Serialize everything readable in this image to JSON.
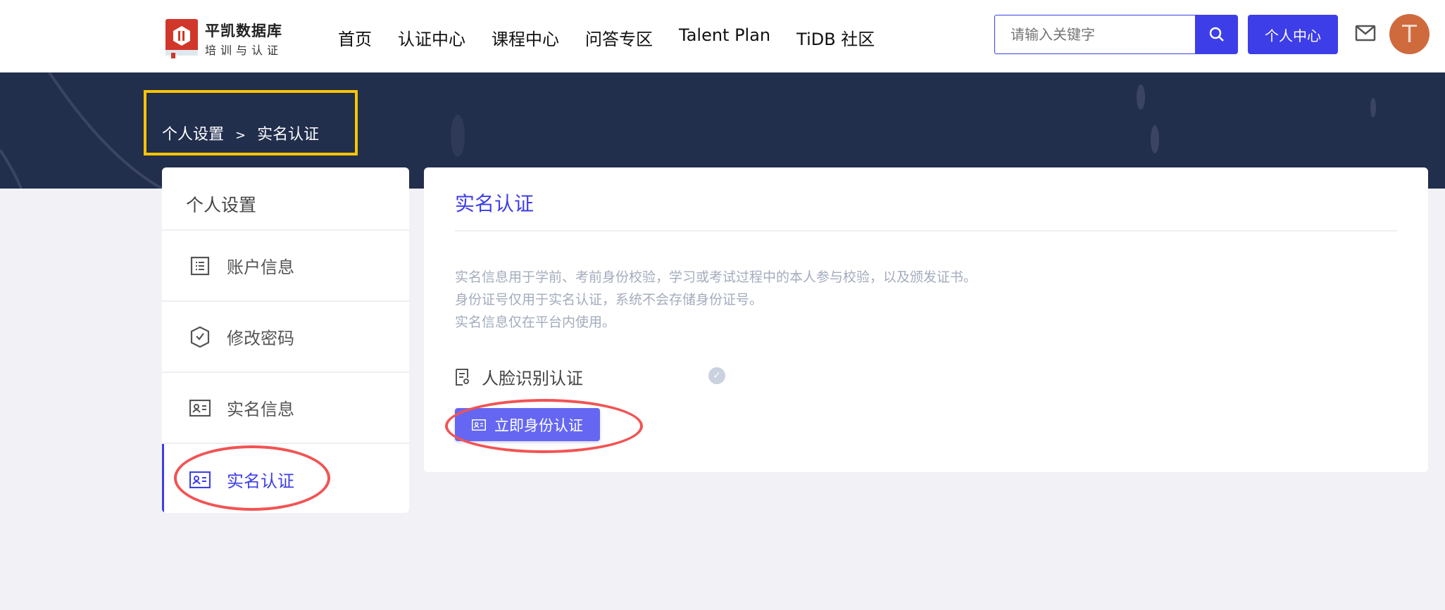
{
  "header": {
    "logo_title": "平凯数据库",
    "logo_subtitle": "培训与认证",
    "nav": [
      "首页",
      "认证中心",
      "课程中心",
      "问答专区",
      "Talent Plan",
      "TiDB 社区"
    ],
    "search_placeholder": "请输入关键字",
    "user_center_label": "个人中心",
    "avatar_letter": "T"
  },
  "breadcrumb": {
    "parent": "个人设置",
    "separator": ">",
    "current": "实名认证"
  },
  "sidebar": {
    "title": "个人设置",
    "items": [
      {
        "label": "账户信息",
        "icon": "list-icon"
      },
      {
        "label": "修改密码",
        "icon": "shield-check-icon"
      },
      {
        "label": "实名信息",
        "icon": "id-card-icon"
      },
      {
        "label": "实名认证",
        "icon": "id-card-icon",
        "active": true
      }
    ]
  },
  "main": {
    "title": "实名认证",
    "description": [
      "实名信息用于学前、考前身份校验，学习或考试过程中的本人参与校验，以及颁发证书。",
      "身份证号仅用于实名认证，系统不会存储身份证号。",
      "实名信息仅在平台内使用。"
    ],
    "face_label": "人脸识别认证",
    "verify_button": "立即身份认证"
  },
  "colors": {
    "accent": "#3d3ee8",
    "banner": "#212e4c",
    "highlight": "#fcc400",
    "annotation": "#f25353",
    "button": "#6567f2"
  }
}
